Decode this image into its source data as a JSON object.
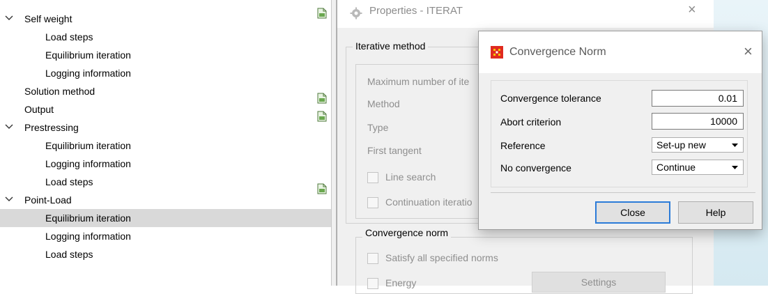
{
  "tree": {
    "items": [
      {
        "label": "Self weight",
        "level": 1,
        "chevron": true,
        "selected": false,
        "icon": false
      },
      {
        "label": "Load steps",
        "level": 2,
        "chevron": false,
        "selected": false,
        "icon": false
      },
      {
        "label": "Equilibrium iteration",
        "level": 2,
        "chevron": false,
        "selected": false,
        "icon": false
      },
      {
        "label": "Logging information",
        "level": 2,
        "chevron": false,
        "selected": false,
        "icon": false
      },
      {
        "label": "Solution method",
        "level": 1,
        "chevron": false,
        "selected": false,
        "icon": false
      },
      {
        "label": "Output",
        "level": 1,
        "chevron": false,
        "selected": false,
        "icon": true
      },
      {
        "label": "Prestressing",
        "level": 1,
        "chevron": true,
        "selected": false,
        "icon": true
      },
      {
        "label": "Equilibrium iteration",
        "level": 2,
        "chevron": false,
        "selected": false,
        "icon": false
      },
      {
        "label": "Logging information",
        "level": 2,
        "chevron": false,
        "selected": false,
        "icon": false
      },
      {
        "label": "Load steps",
        "level": 2,
        "chevron": false,
        "selected": false,
        "icon": false
      },
      {
        "label": "Point-Load",
        "level": 1,
        "chevron": true,
        "selected": false,
        "icon": true
      },
      {
        "label": "Equilibrium iteration",
        "level": 2,
        "chevron": false,
        "selected": true,
        "icon": false
      },
      {
        "label": "Logging information",
        "level": 2,
        "chevron": false,
        "selected": false,
        "icon": false
      },
      {
        "label": "Load steps",
        "level": 2,
        "chevron": false,
        "selected": false,
        "icon": false
      }
    ],
    "icon_name": "green-document-icon"
  },
  "properties": {
    "title": "Properties - ITERAT",
    "close": "×",
    "iterative_group": "Iterative method",
    "max_iter_label": "Maximum number of ite",
    "method_label": "Method",
    "type_label": "Type",
    "first_tangent_label": "First tangent",
    "line_search_label": "Line search",
    "continuation_label": "Continuation iteratio",
    "convergence_group": "Convergence norm",
    "satisfy_label": "Satisfy all specified norms",
    "energy_label": "Energy",
    "settings_label": "Settings"
  },
  "convergence": {
    "title": "Convergence Norm",
    "close": "×",
    "tolerance_label": "Convergence tolerance",
    "tolerance_value": "0.01",
    "abort_label": "Abort criterion",
    "abort_value": "10000",
    "reference_label": "Reference",
    "reference_value": "Set-up new",
    "noconv_label": "No convergence",
    "noconv_value": "Continue",
    "close_button": "Close",
    "help_button": "Help"
  },
  "colors": {
    "selection": "#d9d9d9",
    "primary_button_border": "#2b7bd8",
    "logo_red": "#e02a1f",
    "logo_yellow": "#f5c400"
  }
}
